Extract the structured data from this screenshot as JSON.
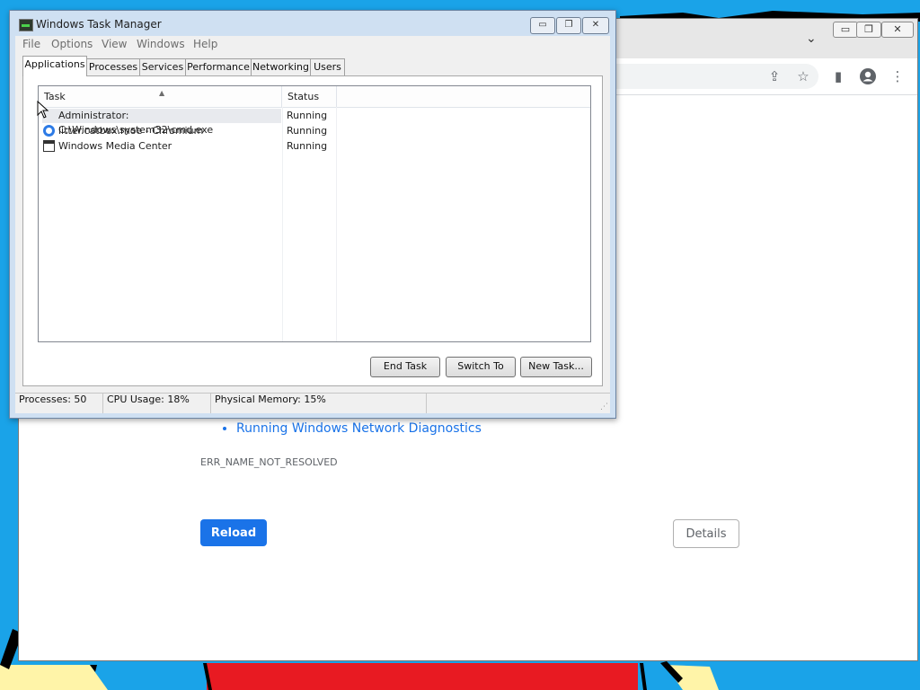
{
  "taskmanager": {
    "title": "Windows Task Manager",
    "caption_buttons": [
      "▭",
      "❐",
      "✕"
    ],
    "menu": [
      "File",
      "Options",
      "View",
      "Windows",
      "Help"
    ],
    "tabs": [
      "Applications",
      "Processes",
      "Services",
      "Performance",
      "Networking",
      "Users"
    ],
    "active_tab": "Applications",
    "columns": {
      "task": "Task",
      "status": "Status"
    },
    "rows": [
      {
        "task": "Administrator: C:\\Windows\\system32\\cmd.exe",
        "status": "Running",
        "icon": "cmd-icon",
        "selected": true
      },
      {
        "task": "litter.catbox.moe - Chromium",
        "status": "Running",
        "icon": "chromium-icon",
        "selected": false
      },
      {
        "task": "Windows Media Center",
        "status": "Running",
        "icon": "window-icon",
        "selected": false
      }
    ],
    "buttons": {
      "end_task": "End Task",
      "switch_to": "Switch To",
      "new_task": "New Task..."
    },
    "statusbar": {
      "processes": "Processes: 50",
      "cpu": "CPU Usage: 18%",
      "memory": "Physical Memory: 15%"
    }
  },
  "browser": {
    "caption_buttons": [
      "▭",
      "❐",
      "✕"
    ],
    "tab_search_icon": "chevron-down-icon",
    "toolbar_icons": [
      "share-icon",
      "star-icon",
      "sidebar-icon",
      "profile-icon",
      "menu-icon"
    ],
    "error_page": {
      "suggestion": "Running Windows Network Diagnostics",
      "error_code": "ERR_NAME_NOT_RESOLVED",
      "reload_label": "Reload",
      "details_label": "Details"
    }
  },
  "colors": {
    "desktop": "#1aa3e8",
    "reload_button": "#1a73e8",
    "link": "#1a73e8"
  }
}
